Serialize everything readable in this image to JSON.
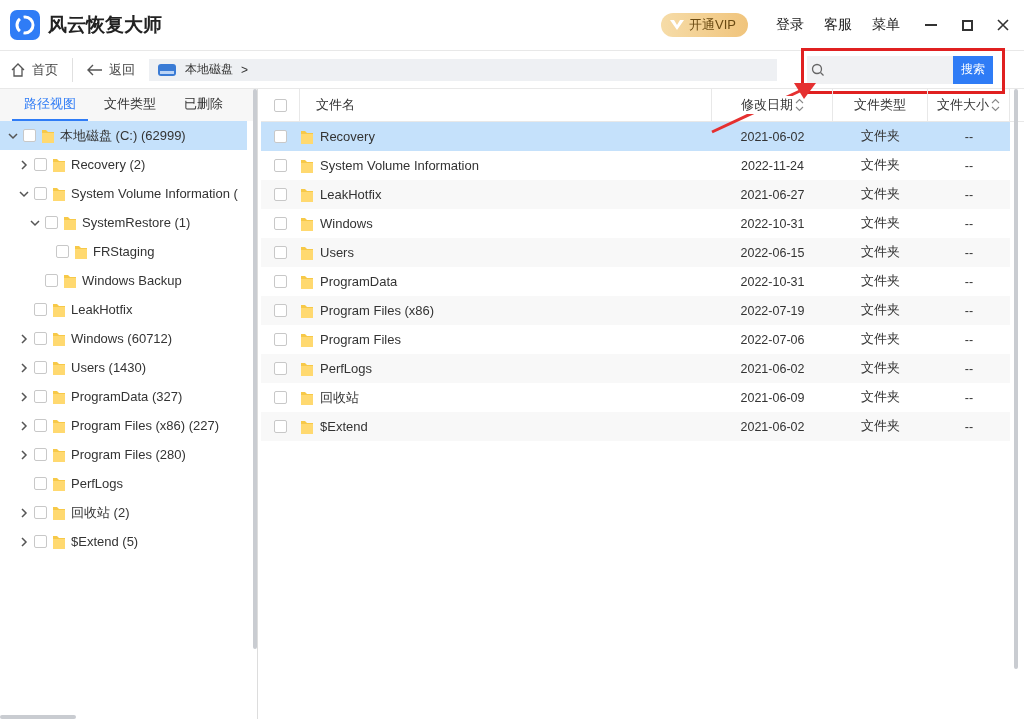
{
  "app": {
    "title": "风云恢复大师",
    "vip_button": "开通VIP",
    "menu": [
      "登录",
      "客服",
      "菜单"
    ]
  },
  "toolbar": {
    "home": "首页",
    "back": "返回",
    "path": "本地磁盘",
    "path_separator": ">",
    "search": {
      "button": "搜索",
      "highlighted": true
    }
  },
  "sidebar": {
    "tabs": [
      {
        "label": "路径视图",
        "selected": true
      },
      {
        "label": "文件类型",
        "selected": false
      },
      {
        "label": "已删除",
        "selected": false
      }
    ],
    "tree": [
      {
        "label": "本地磁盘 (C:) (62999)",
        "checked": false,
        "selected": true,
        "expanded": true,
        "children": [
          {
            "label": "Recovery (2)",
            "checked": false,
            "selected": false,
            "expanded": false
          },
          {
            "label": "System Volume Information (",
            "checked": false,
            "selected": false,
            "expanded": true,
            "children": [
              {
                "label": "SystemRestore (1)",
                "checked": false,
                "selected": false,
                "expanded": true,
                "children": [
                  {
                    "label": "FRStaging",
                    "checked": false,
                    "selected": false
                  }
                ]
              },
              {
                "label": "Windows Backup",
                "checked": false,
                "selected": false
              }
            ]
          },
          {
            "label": "LeakHotfix",
            "checked": false,
            "selected": false
          },
          {
            "label": "Windows (60712)",
            "checked": false,
            "selected": false,
            "expanded": false
          },
          {
            "label": "Users (1430)",
            "checked": false,
            "selected": false,
            "expanded": false
          },
          {
            "label": "ProgramData (327)",
            "checked": false,
            "selected": false,
            "expanded": false
          },
          {
            "label": "Program Files (x86) (227)",
            "checked": false,
            "selected": false,
            "expanded": false
          },
          {
            "label": "Program Files (280)",
            "checked": false,
            "selected": false,
            "expanded": false
          },
          {
            "label": "PerfLogs",
            "checked": false,
            "selected": false
          },
          {
            "label": "回收站 (2)",
            "checked": false,
            "selected": false,
            "expanded": false
          },
          {
            "label": "$Extend (5)",
            "checked": false,
            "selected": false,
            "expanded": false
          }
        ]
      }
    ]
  },
  "table": {
    "all_checked": false,
    "columns": [
      {
        "label": "文件名",
        "sortable": false
      },
      {
        "label": "修改日期",
        "sortable": true
      },
      {
        "label": "文件类型",
        "sortable": false
      },
      {
        "label": "文件大小",
        "sortable": true
      }
    ],
    "rows": [
      {
        "name": "Recovery",
        "date": "2021-06-02",
        "type": "文件夹",
        "size": "--",
        "checked": false,
        "selected": true
      },
      {
        "name": "System Volume Information",
        "date": "2022-11-24",
        "type": "文件夹",
        "size": "--",
        "checked": false,
        "selected": false
      },
      {
        "name": "LeakHotfix",
        "date": "2021-06-27",
        "type": "文件夹",
        "size": "--",
        "checked": false,
        "selected": false
      },
      {
        "name": "Windows",
        "date": "2022-10-31",
        "type": "文件夹",
        "size": "--",
        "checked": false,
        "selected": false
      },
      {
        "name": "Users",
        "date": "2022-06-15",
        "type": "文件夹",
        "size": "--",
        "checked": false,
        "selected": false
      },
      {
        "name": "ProgramData",
        "date": "2022-10-31",
        "type": "文件夹",
        "size": "--",
        "checked": false,
        "selected": false
      },
      {
        "name": "Program Files (x86)",
        "date": "2022-07-19",
        "type": "文件夹",
        "size": "--",
        "checked": false,
        "selected": false
      },
      {
        "name": "Program Files",
        "date": "2022-07-06",
        "type": "文件夹",
        "size": "--",
        "checked": false,
        "selected": false
      },
      {
        "name": "PerfLogs",
        "date": "2021-06-02",
        "type": "文件夹",
        "size": "--",
        "checked": false,
        "selected": false
      },
      {
        "name": "回收站",
        "date": "2021-06-09",
        "type": "文件夹",
        "size": "--",
        "checked": false,
        "selected": false
      },
      {
        "name": "$Extend",
        "date": "2021-06-02",
        "type": "文件夹",
        "size": "--",
        "checked": false,
        "selected": false
      }
    ]
  }
}
